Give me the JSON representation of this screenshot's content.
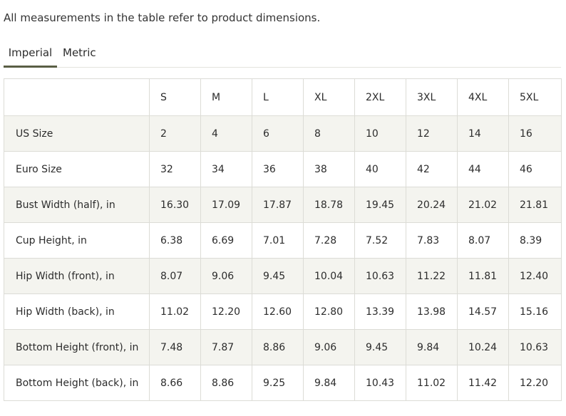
{
  "intro_text": "All measurements in the table refer to product dimensions.",
  "tabs": [
    {
      "label": "Imperial",
      "active": true
    },
    {
      "label": "Metric",
      "active": false
    }
  ],
  "table": {
    "headers": [
      "",
      "S",
      "M",
      "L",
      "XL",
      "2XL",
      "3XL",
      "4XL",
      "5XL"
    ],
    "rows": [
      {
        "label": "US Size",
        "values": [
          "2",
          "4",
          "6",
          "8",
          "10",
          "12",
          "14",
          "16"
        ]
      },
      {
        "label": "Euro Size",
        "values": [
          "32",
          "34",
          "36",
          "38",
          "40",
          "42",
          "44",
          "46"
        ]
      },
      {
        "label": "Bust Width (half), in",
        "values": [
          "16.30",
          "17.09",
          "17.87",
          "18.78",
          "19.45",
          "20.24",
          "21.02",
          "21.81"
        ]
      },
      {
        "label": "Cup Height, in",
        "values": [
          "6.38",
          "6.69",
          "7.01",
          "7.28",
          "7.52",
          "7.83",
          "8.07",
          "8.39"
        ]
      },
      {
        "label": "Hip Width (front), in",
        "values": [
          "8.07",
          "9.06",
          "9.45",
          "10.04",
          "10.63",
          "11.22",
          "11.81",
          "12.40"
        ]
      },
      {
        "label": "Hip Width (back), in",
        "values": [
          "11.02",
          "12.20",
          "12.60",
          "12.80",
          "13.39",
          "13.98",
          "14.57",
          "15.16"
        ]
      },
      {
        "label": "Bottom Height (front), in",
        "values": [
          "7.48",
          "7.87",
          "8.86",
          "9.06",
          "9.45",
          "9.84",
          "10.24",
          "10.63"
        ]
      },
      {
        "label": "Bottom Height (back), in",
        "values": [
          "8.66",
          "8.86",
          "9.25",
          "9.84",
          "10.43",
          "11.02",
          "11.42",
          "12.20"
        ]
      }
    ]
  },
  "colors": {
    "active_tab_underline": "#5a5e45",
    "row_shade": "#f4f4ef",
    "border": "#dcdcd6"
  }
}
